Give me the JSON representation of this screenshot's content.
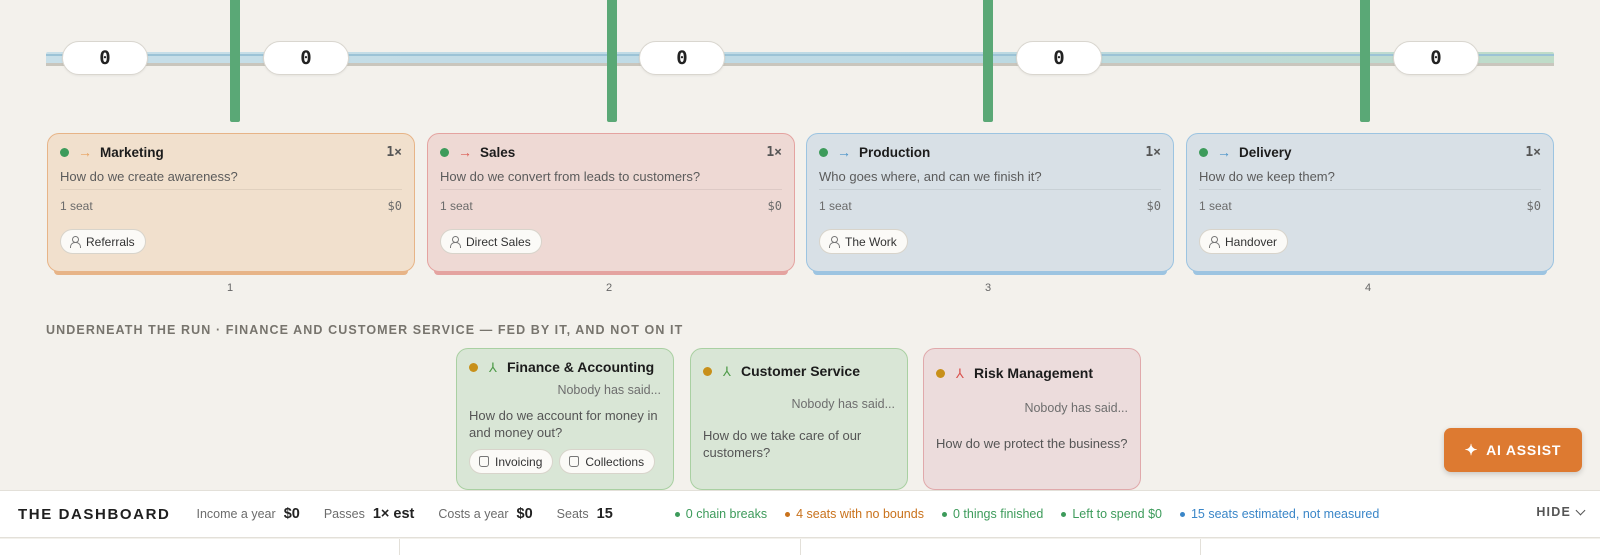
{
  "counters": [
    "0",
    "0",
    "0",
    "0",
    "0"
  ],
  "stages": [
    {
      "name": "Marketing",
      "question": "How do we create awareness?",
      "multiplier": "1×",
      "seats": "1 seat",
      "cost": "$0",
      "role": "Referrals",
      "index": "1",
      "arrow": "→",
      "accent": "#e8a25f",
      "bg": "#f1e0cd",
      "border": "#e7b487",
      "dot": "#3d9b5b"
    },
    {
      "name": "Sales",
      "question": "How do we convert from leads to customers?",
      "multiplier": "1×",
      "seats": "1 seat",
      "cost": "$0",
      "role": "Direct Sales",
      "index": "2",
      "arrow": "→",
      "accent": "#dc5b52",
      "bg": "#eed9d4",
      "border": "#e4a3a0",
      "dot": "#3d9b5b"
    },
    {
      "name": "Production",
      "question": "Who goes where, and can we finish it?",
      "multiplier": "1×",
      "seats": "1 seat",
      "cost": "$0",
      "role": "The Work",
      "index": "3",
      "arrow": "→",
      "accent": "#4a93c9",
      "bg": "#d8e0e6",
      "border": "#9cc4e1",
      "dot": "#3d9b5b"
    },
    {
      "name": "Delivery",
      "question": "How do we keep them?",
      "multiplier": "1×",
      "seats": "1 seat",
      "cost": "$0",
      "role": "Handover",
      "index": "4",
      "arrow": "→",
      "accent": "#4a93c9",
      "bg": "#d8e0e6",
      "border": "#9cc4e1",
      "dot": "#3d9b5b"
    }
  ],
  "underneath_title": "UNDERNEATH THE RUN · FINANCE AND CUSTOMER SERVICE — FED BY IT, AND NOT ON IT",
  "support": [
    {
      "name": "Finance & Accounting",
      "said": "Nobody has said...",
      "question": "How do we account for money in and money out?",
      "chips": [
        "Invoicing",
        "Collections"
      ],
      "bg": "#d9e6d6",
      "border": "#a9d0a2",
      "tri": "#4f9b49"
    },
    {
      "name": "Customer Service",
      "said": "Nobody has said...",
      "question": "How do we take care of our customers?",
      "chips": [],
      "bg": "#d9e6d6",
      "border": "#a9d0a2",
      "tri": "#4f9b49"
    },
    {
      "name": "Risk Management",
      "said": "Nobody has said...",
      "question": "How do we protect the business?",
      "chips": [],
      "bg": "#ecdcdc",
      "border": "#e0a9ab",
      "tri": "#d9534f"
    }
  ],
  "ai_assist": "AI ASSIST",
  "dashboard": {
    "title": "THE DASHBOARD",
    "metrics": [
      {
        "label": "Income a year",
        "value": "$0"
      },
      {
        "label": "Passes",
        "value": "1× est"
      },
      {
        "label": "Costs a year",
        "value": "$0"
      },
      {
        "label": "Seats",
        "value": "15"
      }
    ],
    "statuses": [
      {
        "text": "0 chain breaks",
        "color": "#3d9b5b"
      },
      {
        "text": "4 seats with no bounds",
        "color": "#c9721c"
      },
      {
        "text": "0 things finished",
        "color": "#3d9b5b"
      },
      {
        "text": "Left to spend $0",
        "color": "#3d9b5b"
      },
      {
        "text": "15 seats estimated, not measured",
        "color": "#3a86c8"
      }
    ],
    "hide_label": "HIDE"
  }
}
